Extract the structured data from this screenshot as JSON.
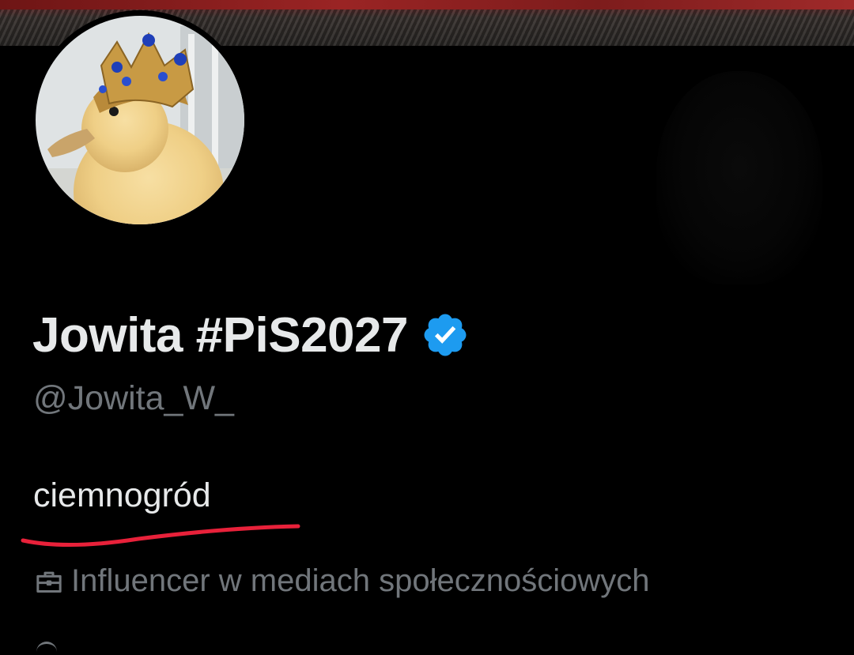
{
  "profile": {
    "display_name": "Jowita #PiS2027",
    "verified_icon": "verified-badge-icon",
    "handle": "@Jowita_W_",
    "bio": "ciemnogród",
    "category_icon": "briefcase-icon",
    "category": "Influencer w mediach społecznościowych"
  },
  "colors": {
    "background": "#000000",
    "primary_text": "#e7e9ea",
    "secondary_text": "#71767b",
    "verified_blue": "#1d9bf0",
    "annotation_red": "#e8213a"
  }
}
